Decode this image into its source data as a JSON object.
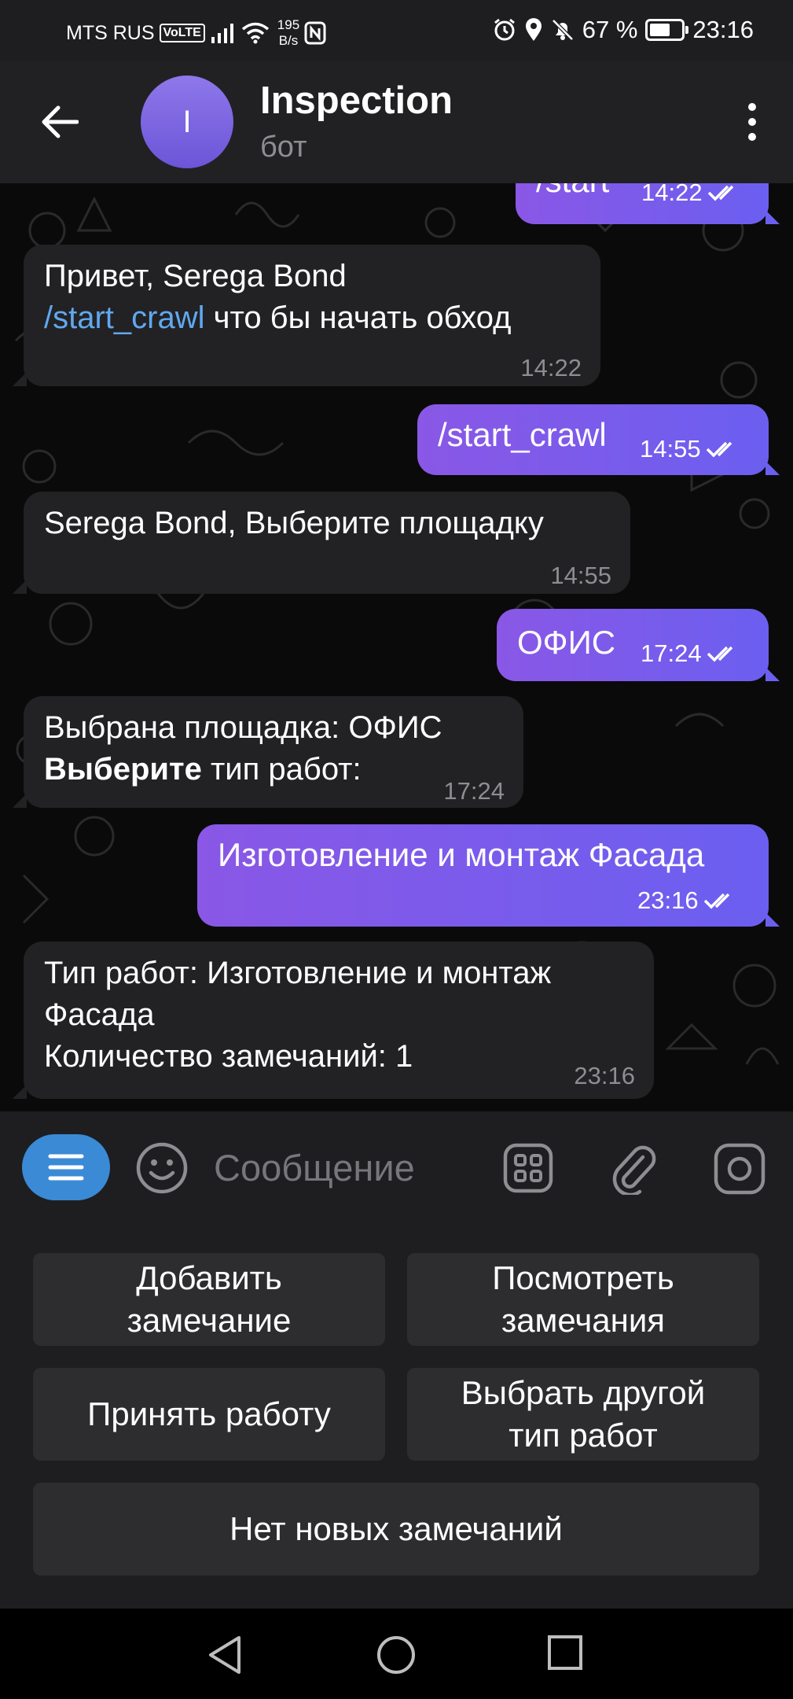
{
  "status": {
    "carrier": "MTS RUS",
    "volte": "VoLTE",
    "rate_value": "195",
    "rate_unit": "B/s",
    "battery": "67 %",
    "battery_level": 0.67,
    "time": "23:16"
  },
  "header": {
    "avatar_letter": "I",
    "title": "Inspection",
    "subtitle": "бот"
  },
  "messages": [
    {
      "dir": "out",
      "text": "/start",
      "time": "14:22"
    },
    {
      "dir": "in",
      "line1": "Привет, Serega Bond",
      "link": "/start_crawl",
      "line2_rest": " что бы начать обход",
      "time": "14:22"
    },
    {
      "dir": "out",
      "text": "/start_crawl",
      "time": "14:55"
    },
    {
      "dir": "in",
      "text": "Serega Bond, Выберите площадку",
      "time": "14:55"
    },
    {
      "dir": "out",
      "text": "ОФИС",
      "time": "17:24"
    },
    {
      "dir": "in",
      "line1": "Выбрана площадка: ОФИС",
      "bold": "Выберите",
      "line2_rest": " тип работ:",
      "time": "17:24"
    },
    {
      "dir": "out",
      "text": "Изготовление и монтаж Фасада",
      "time": "23:16"
    },
    {
      "dir": "in",
      "line1": "Тип работ: Изготовление и монтаж",
      "line2": "Фасада",
      "line3": "Количество замечаний:  1",
      "time": "23:16"
    }
  ],
  "input": {
    "placeholder": "Сообщение"
  },
  "keyboard": {
    "add_line1": "Добавить",
    "add_line2": "замечание",
    "view_line1": "Посмотреть",
    "view_line2": "замечания",
    "accept": "Принять работу",
    "choose_line1": "Выбрать другой",
    "choose_line2": "тип работ",
    "no_new": "Нет новых замечаний"
  },
  "colors": {
    "accent": "#6b5ff0",
    "link": "#61a8f0",
    "menu_button": "#3b8ad6"
  }
}
